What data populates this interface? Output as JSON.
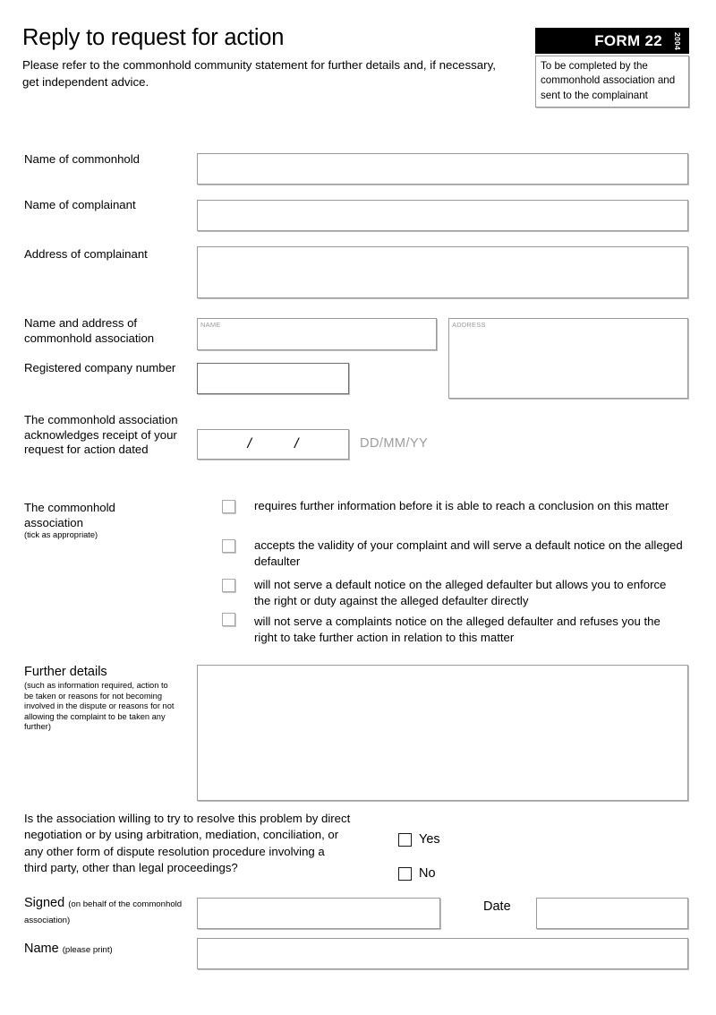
{
  "header": {
    "title": "Reply to request for action",
    "subtitle": "Please refer to the commonhold community statement for further details and, if necessary, get independent advice.",
    "form_badge": "FORM 22",
    "form_year": "2004",
    "badge_note": "To be completed by the commonhold association and sent to the complainant"
  },
  "fields": {
    "name_of_commonhold": {
      "label": "Name of commonhold",
      "value": ""
    },
    "name_of_complainant": {
      "label": "Name of complainant",
      "value": ""
    },
    "address_of_complainant": {
      "label": "Address of complainant",
      "value": ""
    },
    "name_and_address": {
      "label": "Name and address of commonhold association",
      "name_placeholder": "NAME",
      "address_placeholder": "ADDRESS",
      "name_value": "",
      "address_value": ""
    },
    "registered_company_number": {
      "label": "Registered company number",
      "value": ""
    },
    "acknowledgement_date": {
      "label": "The commonhold association acknowledges receipt of your request for action dated",
      "value": "",
      "separator": "/",
      "format_hint": "DD/MM/YY"
    },
    "further_details": {
      "label": "Further details",
      "sublabel": "(such as information required, action to be taken or reasons for not becoming involved in the dispute or reasons for not allowing the complaint to be taken any further)",
      "value": ""
    },
    "signed": {
      "label": "Signed",
      "sublabel": "(on behalf of the commonhold association)",
      "value": ""
    },
    "date": {
      "label": "Date",
      "value": ""
    },
    "name_print": {
      "label": "Name",
      "sublabel": "(please print)",
      "value": ""
    }
  },
  "association_options": {
    "label": "The commonhold association",
    "sublabel": "(tick as appropriate)",
    "items": [
      {
        "text": "requires further information before it is able to reach a conclusion on this matter",
        "checked": false
      },
      {
        "text": "accepts the validity of your complaint and will serve a default notice on the alleged defaulter",
        "checked": false
      },
      {
        "text": "will not serve a default notice on the alleged defaulter but allows you to enforce the right or duty against the alleged defaulter directly",
        "checked": false
      },
      {
        "text": "will not serve a complaints notice on the alleged defaulter and refuses you the right to take further action in relation to this matter",
        "checked": false
      }
    ]
  },
  "resolution_question": {
    "text": "Is the association willing to try to resolve this problem by direct negotiation or by using arbitration, mediation, conciliation, or any other form of dispute resolution procedure involving a third party, other than legal proceedings?",
    "yes_label": "Yes",
    "no_label": "No",
    "yes_checked": false,
    "no_checked": false
  },
  "colors": {
    "badge_background": "#000000",
    "badge_text": "#ffffff",
    "box_border": "#9a9a9a",
    "hint_text": "#9d9d9d"
  }
}
